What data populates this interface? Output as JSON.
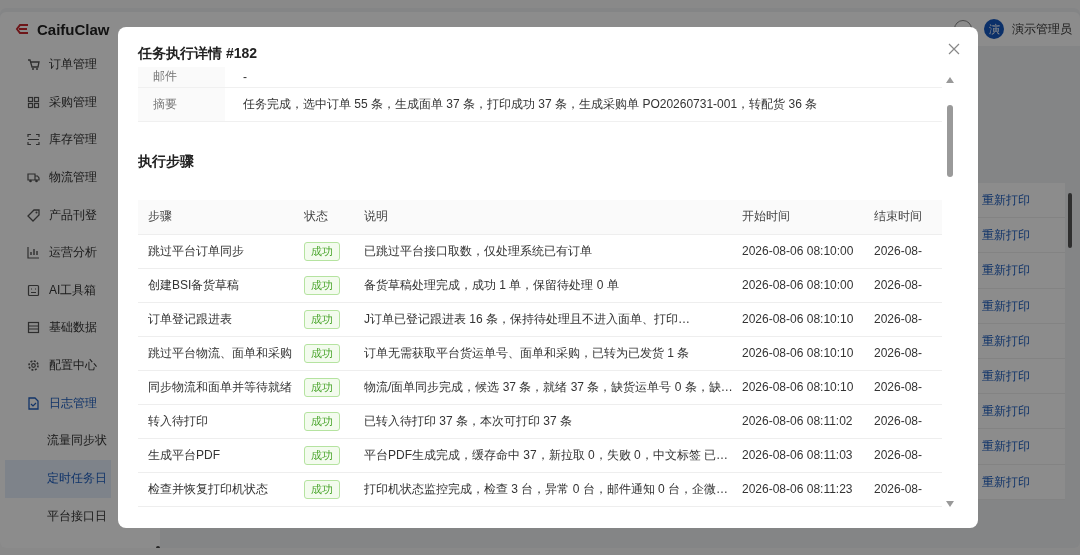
{
  "header": {
    "brand": "CaifuClaw",
    "user": {
      "avatar": "演",
      "name": "演示管理员"
    }
  },
  "sidebar": {
    "items": [
      {
        "label": "订单管理",
        "selected": false
      },
      {
        "label": "采购管理",
        "selected": false
      },
      {
        "label": "库存管理",
        "selected": false
      },
      {
        "label": "物流管理",
        "selected": false
      },
      {
        "label": "产品刊登",
        "selected": false
      },
      {
        "label": "运营分析",
        "selected": false
      },
      {
        "label": "AI工具箱",
        "selected": false
      },
      {
        "label": "基础数据",
        "selected": false
      },
      {
        "label": "配置中心",
        "selected": false
      },
      {
        "label": "日志管理",
        "selected": true,
        "expanded": true,
        "children": [
          {
            "label": "流量同步状",
            "selected": false
          },
          {
            "label": "定时任务日",
            "selected": true
          },
          {
            "label": "平台接口日",
            "selected": false
          }
        ]
      }
    ]
  },
  "background_table": {
    "actions": [
      "重新打印",
      "重新打印",
      "重新打印",
      "重新打印",
      "重新打印",
      "重新打印",
      "重新打印",
      "重新打印",
      "重新打印"
    ]
  },
  "modal": {
    "title": "任务执行详情 #182",
    "info": [
      {
        "label": "邮件",
        "value": "-"
      },
      {
        "label": "摘要",
        "value": "任务完成，选中订单 55 条，生成面单 37 条，打印成功 37 条，生成采购单 PO20260731-001，转配货 36 条"
      }
    ],
    "steps_heading": "执行步骤",
    "steps": {
      "columns": [
        "步骤",
        "状态",
        "说明",
        "开始时间",
        "结束时间"
      ],
      "rows": [
        {
          "step": "跳过平台订单同步",
          "status": {
            "label": "成功",
            "kind": "success"
          },
          "description": "已跳过平台接口取数，仅处理系统已有订单",
          "start": "2026-08-06 08:10:00",
          "end": "2026-08-"
        },
        {
          "step": "创建BSI备货草稿",
          "status": {
            "label": "成功",
            "kind": "success"
          },
          "description": "备货草稿处理完成，成功 1 单，保留待处理 0 单",
          "start": "2026-08-06 08:10:00",
          "end": "2026-08-"
        },
        {
          "step": "订单登记跟进表",
          "status": {
            "label": "成功",
            "kind": "success"
          },
          "description": "J订单已登记跟进表 16 条，保持待处理且不进入面单、打印…",
          "start": "2026-08-06 08:10:10",
          "end": "2026-08-"
        },
        {
          "step": "跳过平台物流、面单和采购",
          "status": {
            "label": "成功",
            "kind": "success"
          },
          "description": "订单无需获取平台货运单号、面单和采购，已转为已发货 1 条",
          "start": "2026-08-06 08:10:10",
          "end": "2026-08-"
        },
        {
          "step": "同步物流和面单并等待就绪",
          "status": {
            "label": "成功",
            "kind": "success"
          },
          "description": "物流/面单同步完成，候选 37 条，就绪 37 条，缺货运单号 0 条，缺…",
          "start": "2026-08-06 08:10:10",
          "end": "2026-08-"
        },
        {
          "step": "转入待打印",
          "status": {
            "label": "成功",
            "kind": "success"
          },
          "description": "已转入待打印 37 条，本次可打印 37 条",
          "start": "2026-08-06 08:11:02",
          "end": "2026-08-"
        },
        {
          "step": "生成平台PDF",
          "status": {
            "label": "成功",
            "kind": "success"
          },
          "description": "平台PDF生成完成，缓存命中 37，新拉取 0，失败 0，中文标签 已…",
          "start": "2026-08-06 08:11:03",
          "end": "2026-08-"
        },
        {
          "step": "检查并恢复打印机状态",
          "status": {
            "label": "成功",
            "kind": "success"
          },
          "description": "打印机状态监控完成，检查 3 台，异常 0 台，邮件通知 0 台，企微…",
          "start": "2026-08-06 08:11:23",
          "end": "2026-08-"
        }
      ]
    }
  }
}
